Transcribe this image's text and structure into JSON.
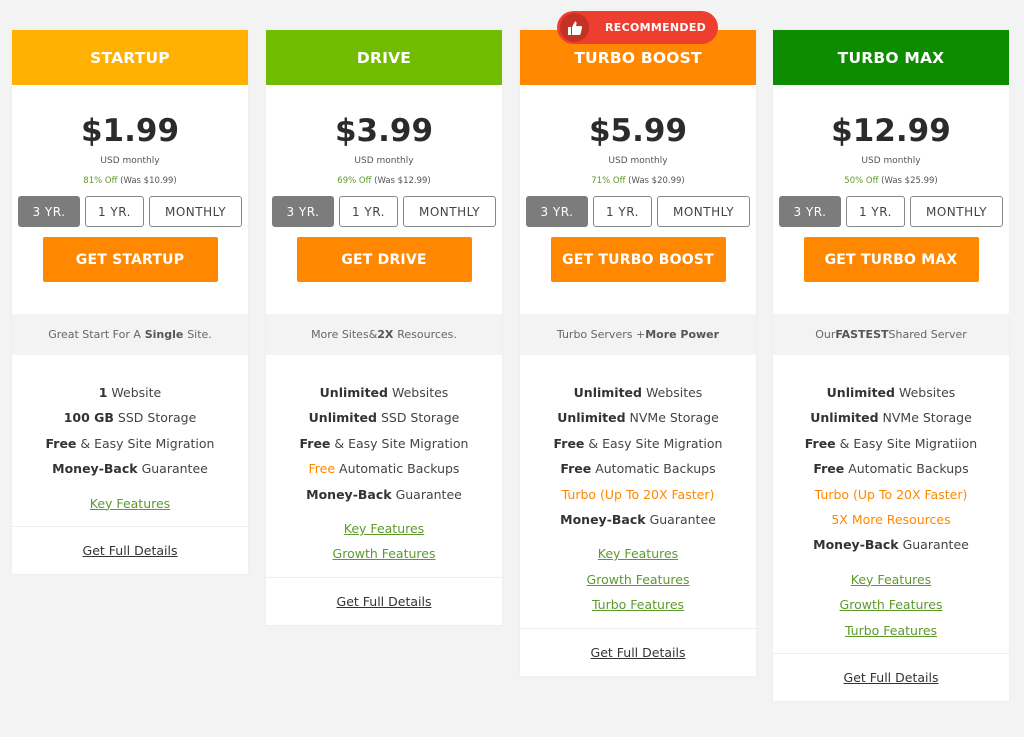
{
  "badge": {
    "label": "RECOMMENDED",
    "icon": "thumbs-up-icon",
    "color": "#ee3e2f"
  },
  "plans": [
    {
      "name": "STARTUP",
      "header_color": "#ffb000",
      "price": "$1.99",
      "unit": "USD monthly",
      "discount": "81% Off",
      "was": "(Was $10.99)",
      "terms": [
        "3 YR.",
        "1 YR.",
        "MONTHLY"
      ],
      "cta": "GET STARTUP",
      "tagline": "Great Start For A Single Site.",
      "features": [
        "1 Website",
        "100 GB SSD Storage",
        "Free & Easy Site Migration",
        "Money-Back Guarantee"
      ],
      "links": [
        "Key Features"
      ],
      "details": "Get Full Details"
    },
    {
      "name": "DRIVE",
      "header_color": "#71bc00",
      "price": "$3.99",
      "unit": "USD monthly",
      "discount": "69% Off",
      "was": "(Was $12.99)",
      "terms": [
        "3 YR.",
        "1 YR.",
        "MONTHLY"
      ],
      "cta": "GET DRIVE",
      "tagline": "More Sites & 2X Resources.",
      "features": [
        "Unlimited Websites",
        "Unlimited SSD Storage",
        "Free & Easy Site Migration",
        "Free Automatic Backups",
        "Money-Back Guarantee"
      ],
      "links": [
        "Key Features",
        "Growth Features"
      ],
      "details": "Get Full Details"
    },
    {
      "name": "TURBO BOOST",
      "header_color": "#ff8800",
      "price": "$5.99",
      "unit": "USD monthly",
      "discount": "71% Off",
      "was": "(Was $20.99)",
      "terms": [
        "3 YR.",
        "1 YR.",
        "MONTHLY"
      ],
      "cta": "GET TURBO BOOST",
      "tagline": "Turbo Servers + More Power",
      "features": [
        "Unlimited Websites",
        "Unlimited NVMe Storage",
        "Free & Easy Site Migration",
        "Free Automatic Backups",
        "Turbo (Up To 20X Faster)",
        "Money-Back Guarantee"
      ],
      "links": [
        "Key Features",
        "Growth Features",
        "Turbo Features"
      ],
      "details": "Get Full Details"
    },
    {
      "name": "TURBO MAX",
      "header_color": "#0e8c00",
      "price": "$12.99",
      "unit": "USD monthly",
      "discount": "50% Off",
      "was": "(Was $25.99)",
      "terms": [
        "3 YR.",
        "1 YR.",
        "MONTHLY"
      ],
      "cta": "GET TURBO MAX",
      "tagline": "Our FASTEST Shared Server",
      "features": [
        "Unlimited Websites",
        "Unlimited NVMe Storage",
        "Free & Easy Site Migratiion",
        "Free Automatic Backups",
        "Turbo (Up To 20X Faster)",
        "5X More Resources",
        "Money-Back Guarantee"
      ],
      "links": [
        "Key Features",
        "Growth Features",
        "Turbo Features"
      ],
      "details": "Get Full Details"
    }
  ],
  "colors": {
    "cta": "#ff8800",
    "link": "#5d9a2c",
    "selected_term": "#7c7c7c"
  }
}
